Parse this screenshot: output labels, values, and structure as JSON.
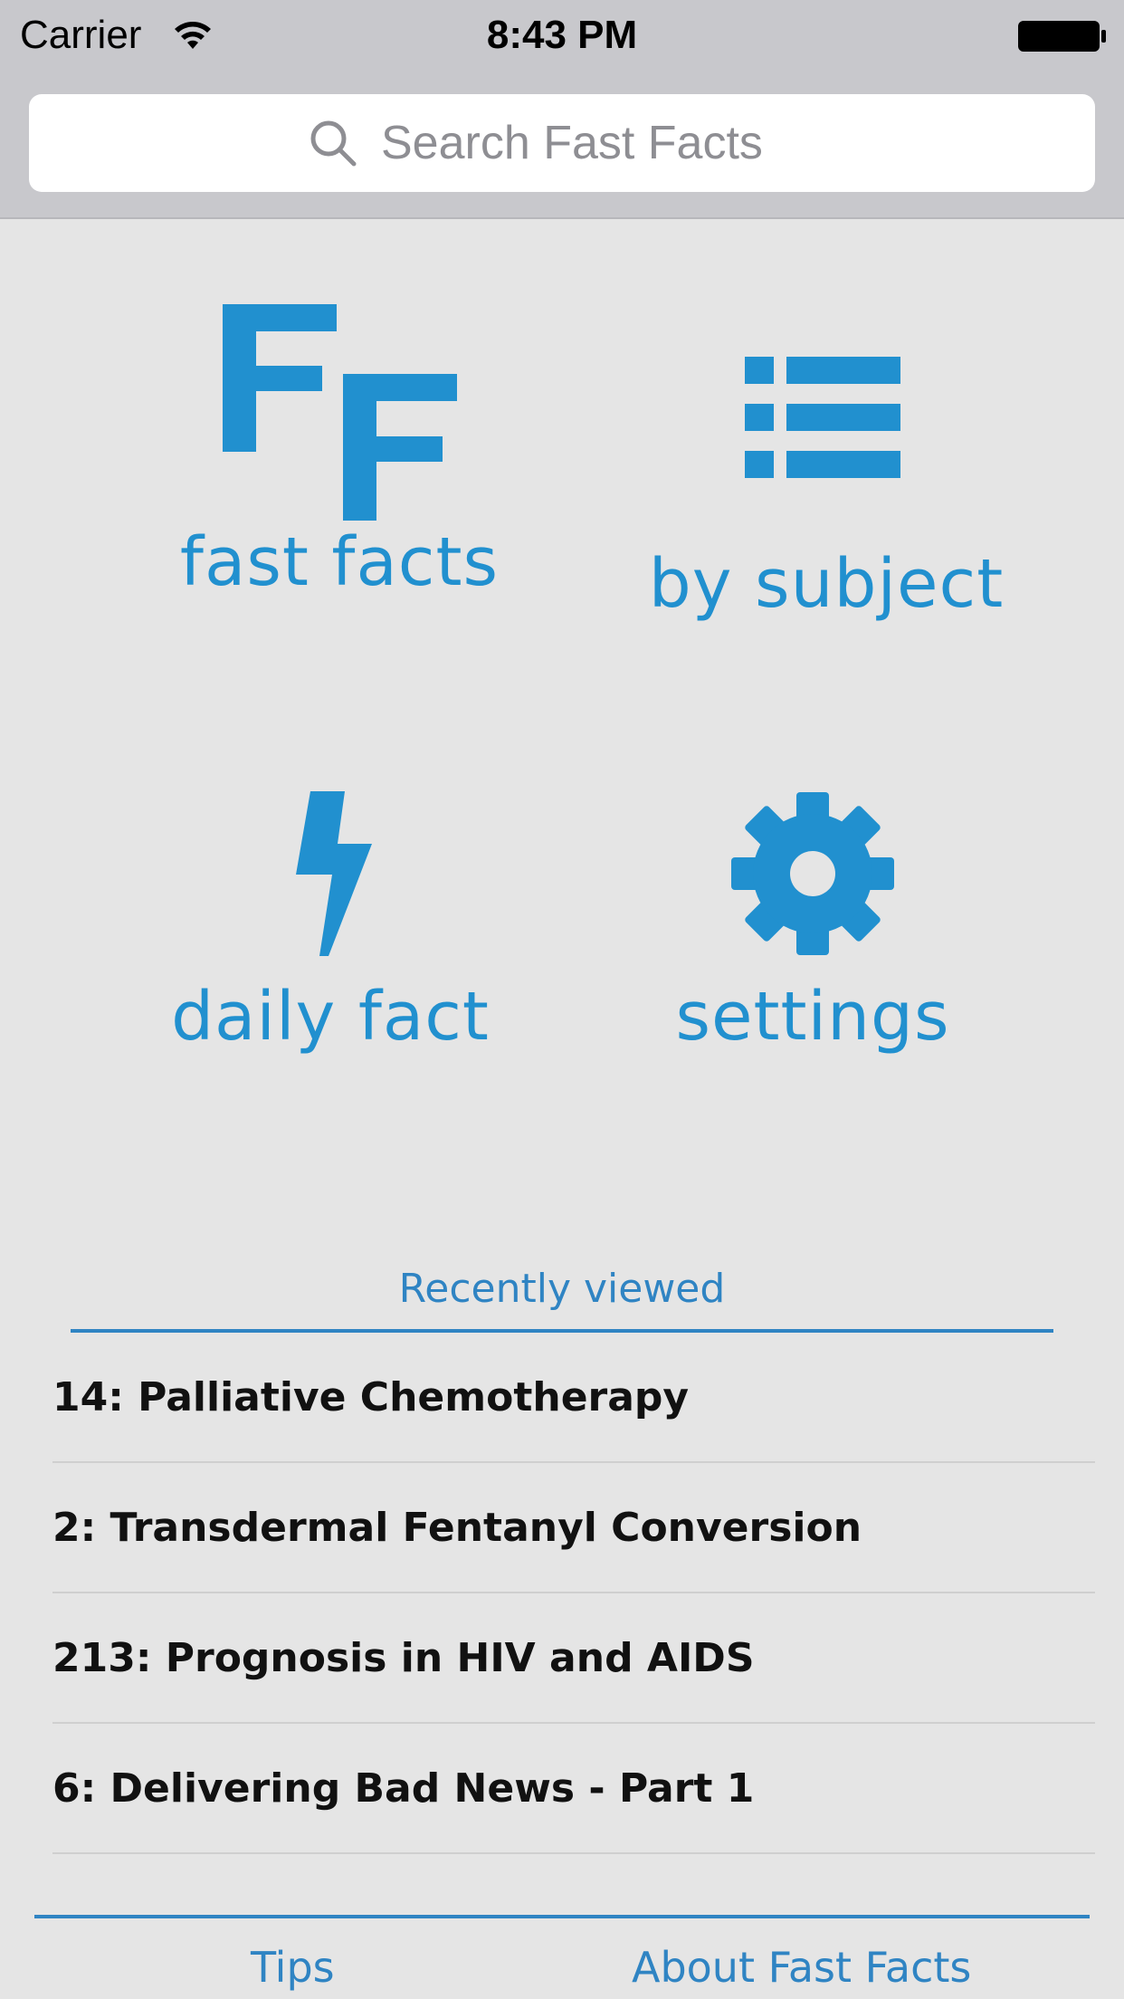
{
  "status_bar": {
    "carrier": "Carrier",
    "time": "8:43 PM"
  },
  "search": {
    "placeholder": "Search Fast Facts",
    "icon": "search-icon"
  },
  "tiles": [
    {
      "label": "fast facts",
      "icon": "fast-facts-logo-icon"
    },
    {
      "label": "by subject",
      "icon": "list-icon"
    },
    {
      "label": "daily fact",
      "icon": "lightning-bolt-icon"
    },
    {
      "label": "settings",
      "icon": "gear-icon"
    }
  ],
  "recent": {
    "title": "Recently viewed",
    "items": [
      "14: Palliative Chemotherapy",
      "2: Transdermal Fentanyl Conversion",
      "213: Prognosis in HIV and AIDS",
      "6: Delivering Bad News - Part 1"
    ]
  },
  "footer": {
    "tips": "Tips",
    "about": "About Fast Facts"
  },
  "colors": {
    "accent": "#2190cf",
    "link": "#2f84c3",
    "background": "#e5e5e5",
    "header": "#c8c8cc"
  }
}
